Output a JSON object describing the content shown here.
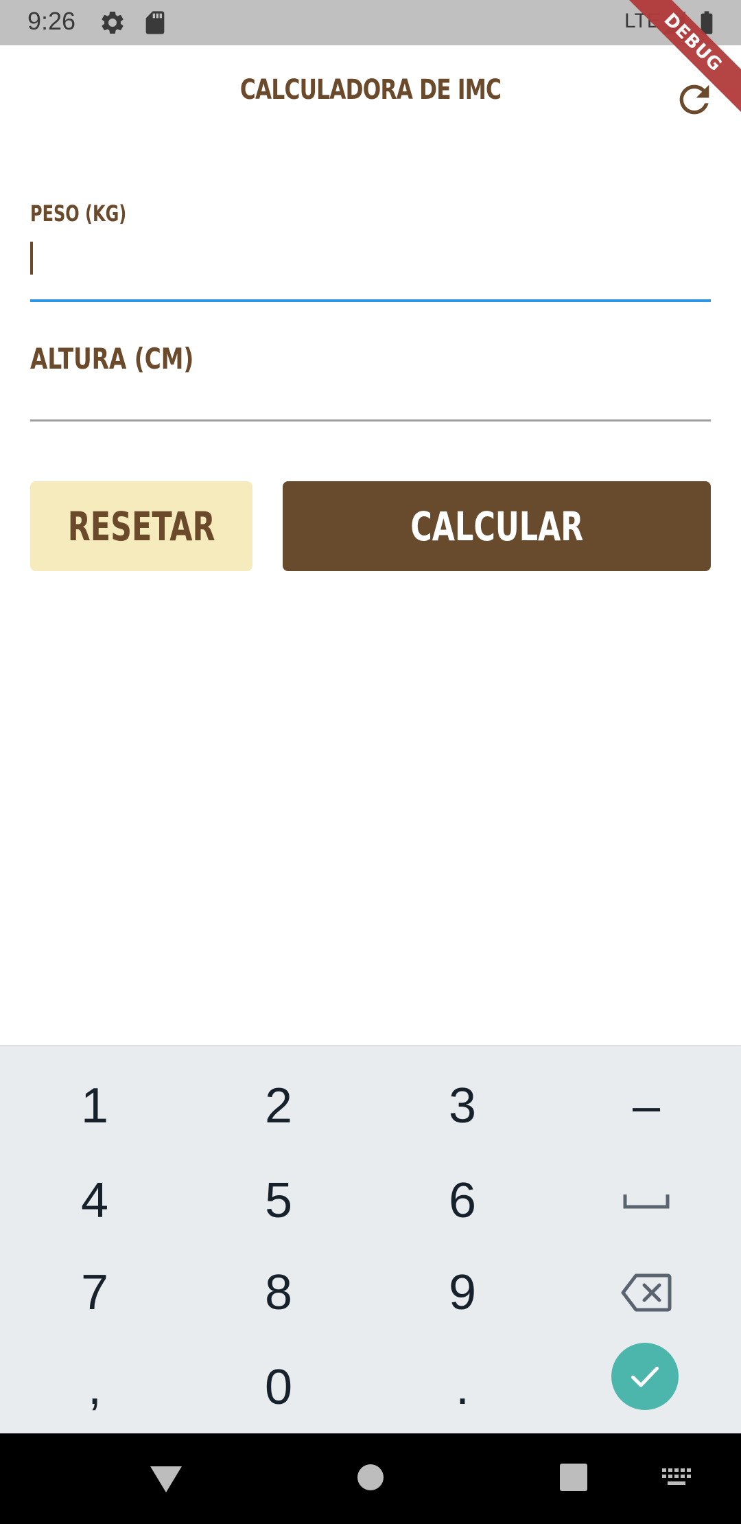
{
  "status_bar": {
    "time": "9:26",
    "network": "LTE",
    "icons": [
      "settings-icon",
      "sd-card-icon",
      "signal-icon",
      "battery-icon"
    ]
  },
  "debug_banner": "DEBUG",
  "app_bar": {
    "title": "CALCULADORA DE IMC",
    "refresh_icon": "refresh-icon"
  },
  "form": {
    "peso": {
      "label": "PESO (KG)",
      "value": ""
    },
    "altura": {
      "label": "ALTURA (CM)",
      "value": ""
    }
  },
  "buttons": {
    "reset": "RESETAR",
    "calculate": "CALCULAR"
  },
  "keyboard": {
    "keys": [
      "1",
      "2",
      "3",
      "–",
      "4",
      "5",
      "6",
      "␣",
      "7",
      "8",
      "9",
      "backspace-icon",
      ",",
      "0",
      ".",
      "done-icon"
    ],
    "row1": [
      "1",
      "2",
      "3",
      "–"
    ],
    "row2": [
      "4",
      "5",
      "6"
    ],
    "row3": [
      "7",
      "8",
      "9"
    ],
    "row4": [
      ",",
      "0",
      "."
    ]
  },
  "nav_bar": {
    "icons": [
      "back-icon",
      "home-icon",
      "recents-icon",
      "keyboard-switch-icon"
    ]
  },
  "colors": {
    "brown": "#6b4a2b",
    "button_brown": "#684a2c",
    "cream": "#f6ebbd",
    "focus_blue": "#2f96e6",
    "teal": "#4db6ac",
    "debug_red": "#b23a3a"
  }
}
